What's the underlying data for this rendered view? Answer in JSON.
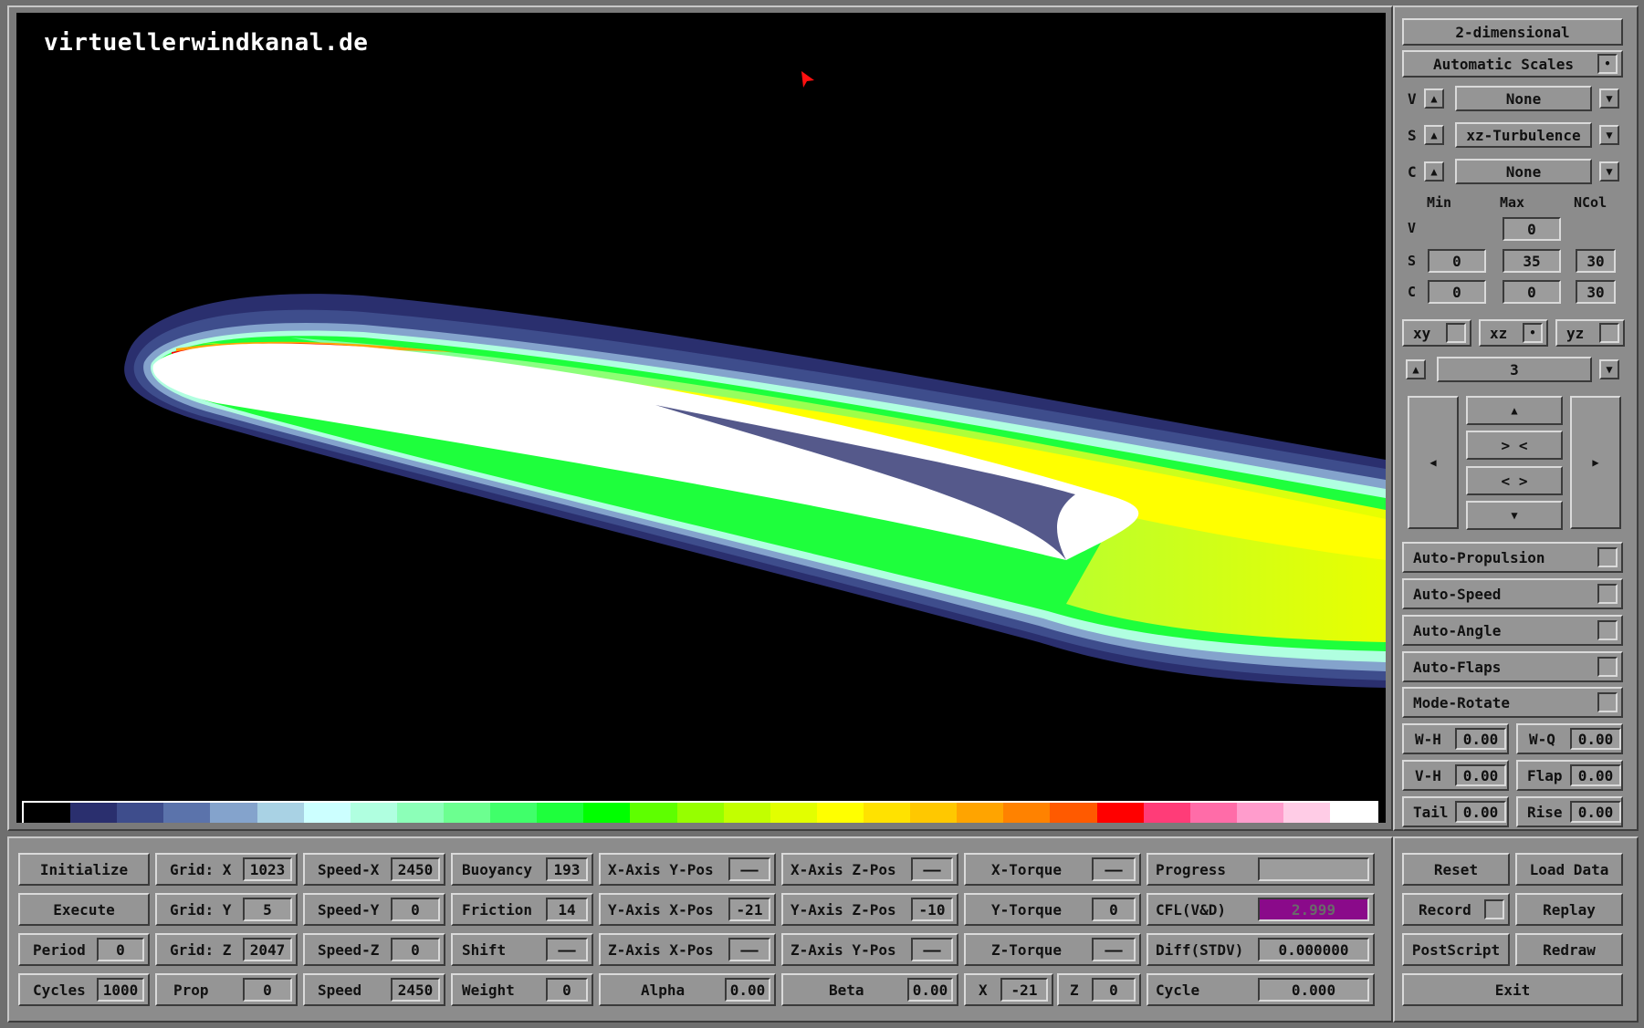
{
  "site_label": "virtuellerwindkanal.de",
  "colorbar": [
    "#000000",
    "#2a2f6e",
    "#3e4d8c",
    "#5b73ab",
    "#84a3cc",
    "#a9d2e4",
    "#ccffff",
    "#b0ffe0",
    "#8cffb8",
    "#6cff90",
    "#40ff6a",
    "#1eff3c",
    "#00ff00",
    "#5eff00",
    "#96ff00",
    "#c2ff00",
    "#e2ff00",
    "#ffff00",
    "#ffe200",
    "#ffc800",
    "#ffa400",
    "#ff8200",
    "#ff5a00",
    "#ff0000",
    "#ff3c78",
    "#ff6ca8",
    "#ff9ccc",
    "#ffcce6",
    "#ffffff"
  ],
  "side": {
    "mode_label": "2-dimensional",
    "auto_scales_label": "Automatic Scales",
    "v_label": "V",
    "v_value": "None",
    "s_label": "S",
    "s_value": "xz-Turbulence",
    "c_label": "C",
    "c_value": "None",
    "col_min": "Min",
    "col_max": "Max",
    "col_ncol": "NCol",
    "v_max": "0",
    "s_min": "0",
    "s_max": "35",
    "s_ncol": "30",
    "c_min": "0",
    "c_max": "0",
    "c_ncol": "30",
    "plane_xy": "xy",
    "plane_xz": "xz",
    "plane_yz": "yz",
    "slice_value": "3",
    "pan_up": "▲",
    "zoom_in": "> <",
    "zoom_out": "< >",
    "pan_down": "▼",
    "pan_left": "◀",
    "pan_right": "▶",
    "toggles": [
      "Auto-Propulsion",
      "Auto-Speed",
      "Auto-Angle",
      "Auto-Flaps",
      "Mode-Rotate"
    ],
    "wh_label": "W-H",
    "wh_value": "0.00",
    "wq_label": "W-Q",
    "wq_value": "0.00",
    "vh_label": "V-H",
    "vh_value": "0.00",
    "flap_label": "Flap",
    "flap_value": "0.00",
    "tail_label": "Tail",
    "tail_value": "0.00",
    "rise_label": "Rise",
    "rise_value": "0.00"
  },
  "bottom": {
    "initialize": "Initialize",
    "execute": "Execute",
    "period_label": "Period",
    "period_value": "0",
    "cycles_label": "Cycles",
    "cycles_value": "1000",
    "gridx_label": "Grid: X",
    "gridx_value": "1023",
    "gridy_label": "Grid: Y",
    "gridy_value": "5",
    "gridz_label": "Grid: Z",
    "gridz_value": "2047",
    "prop_label": "Prop",
    "prop_value": "0",
    "speedx_label": "Speed-X",
    "speedx_value": "2450",
    "speedy_label": "Speed-Y",
    "speedy_value": "0",
    "speedz_label": "Speed-Z",
    "speedz_value": "0",
    "speed_label": "Speed",
    "speed_value": "2450",
    "buoyancy_label": "Buoyancy",
    "buoyancy_value": "193",
    "friction_label": "Friction",
    "friction_value": "14",
    "shift_label": "Shift",
    "shift_value": "——",
    "weight_label": "Weight",
    "weight_value": "0",
    "xay_label": "X-Axis Y-Pos",
    "xay_value": "——",
    "yax_label": "Y-Axis X-Pos",
    "yax_value": "-21",
    "zax_label": "Z-Axis X-Pos",
    "zax_value": "——",
    "alpha_label": "Alpha",
    "alpha_value": "0.00",
    "xaz_label": "X-Axis Z-Pos",
    "xaz_value": "——",
    "yaz_label": "Y-Axis Z-Pos",
    "yaz_value": "-10",
    "zay_label": "Z-Axis Y-Pos",
    "zay_value": "——",
    "beta_label": "Beta",
    "beta_value": "0.00",
    "xt_label": "X-Torque",
    "xt_value": "——",
    "yt_label": "Y-Torque",
    "yt_value": "0",
    "zt_label": "Z-Torque",
    "zt_value": "——",
    "x_label": "X",
    "x_value": "-21",
    "z_label": "Z",
    "z_value": "0",
    "progress_label": "Progress",
    "progress_fraction": 0,
    "cfl_label": "CFL(V&D)",
    "cfl_value": "2.999",
    "diff_label": "Diff(STDV)",
    "diff_value": "0.000000",
    "cycle_label": "Cycle",
    "cycle_value": "0.000"
  },
  "actions": {
    "reset": "Reset",
    "load_data": "Load Data",
    "record": "Record",
    "replay": "Replay",
    "postscript": "PostScript",
    "redraw": "Redraw",
    "exit": "Exit"
  }
}
